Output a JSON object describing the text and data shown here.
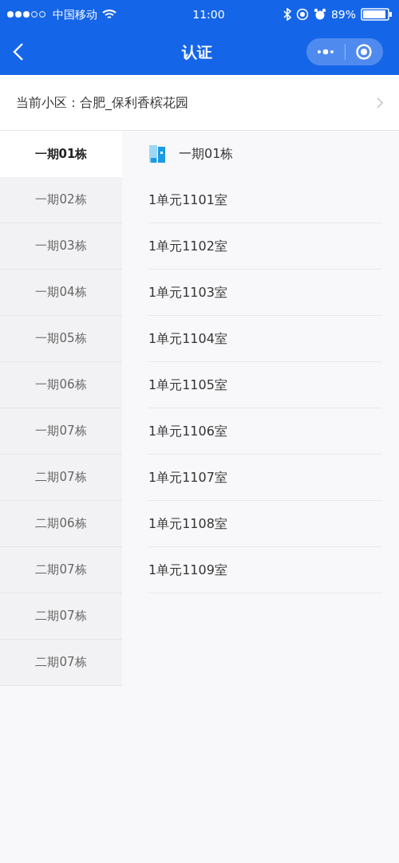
{
  "status_bar": {
    "carrier": "中国移动",
    "time": "11:00",
    "battery": "89%"
  },
  "nav_bar": {
    "title": "认证"
  },
  "community": {
    "label": "当前小区：",
    "value": "合肥_保利香槟花园"
  },
  "buildings": [
    {
      "label": "一期01栋",
      "selected": true
    },
    {
      "label": "一期02栋",
      "selected": false
    },
    {
      "label": "一期03栋",
      "selected": false
    },
    {
      "label": "一期04栋",
      "selected": false
    },
    {
      "label": "一期05栋",
      "selected": false
    },
    {
      "label": "一期06栋",
      "selected": false
    },
    {
      "label": "一期07栋",
      "selected": false
    },
    {
      "label": "二期07栋",
      "selected": false
    },
    {
      "label": "二期06栋",
      "selected": false
    },
    {
      "label": "二期07栋",
      "selected": false
    },
    {
      "label": "二期07栋",
      "selected": false
    },
    {
      "label": "二期07栋",
      "selected": false
    }
  ],
  "rooms_header": "一期01栋",
  "rooms": [
    "1单元1101室",
    "1单元1102室",
    "1单元1103室",
    "1单元1104室",
    "1单元1105室",
    "1单元1106室",
    "1单元1107室",
    "1单元1108室",
    "1单元1109室"
  ]
}
